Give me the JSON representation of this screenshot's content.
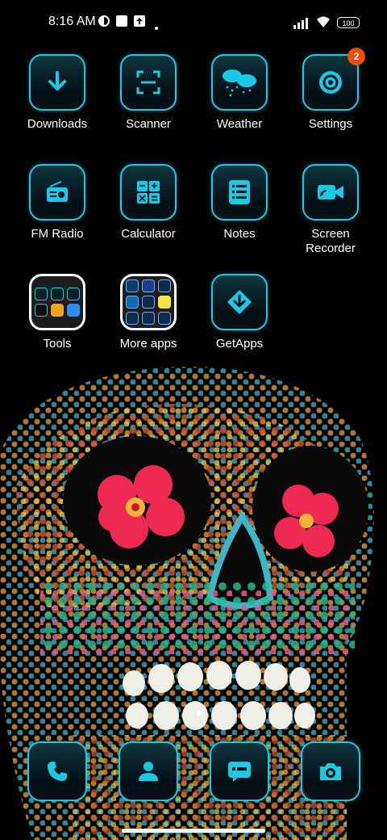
{
  "status_bar": {
    "time": "8:16 AM",
    "battery": "100",
    "icons": [
      "do-not-disturb-icon",
      "notification-square-icon",
      "upload-icon",
      "dot-icon",
      "signal-icon",
      "wifi-icon",
      "battery-icon"
    ]
  },
  "apps": [
    {
      "label": "Downloads",
      "icon": "download-arrow-icon"
    },
    {
      "label": "Scanner",
      "icon": "scanner-icon"
    },
    {
      "label": "Weather",
      "icon": "weather-icon"
    },
    {
      "label": "Settings",
      "icon": "gear-icon",
      "badge": "2"
    },
    {
      "label": "FM Radio",
      "icon": "radio-icon"
    },
    {
      "label": "Calculator",
      "icon": "calculator-icon"
    },
    {
      "label": "Notes",
      "icon": "notes-icon"
    },
    {
      "label": "Screen\nRecorder",
      "icon": "video-camera-icon"
    },
    {
      "label": "Tools",
      "icon": "folder-icon"
    },
    {
      "label": "More apps",
      "icon": "folder-icon"
    },
    {
      "label": "GetApps",
      "icon": "getapps-icon"
    }
  ],
  "dock": [
    {
      "icon": "phone-icon"
    },
    {
      "icon": "contacts-icon"
    },
    {
      "icon": "messages-icon"
    },
    {
      "icon": "camera-icon"
    }
  ],
  "colors": {
    "accent": "#19c9e6",
    "badge": "#f04e0a",
    "background": "#000000"
  }
}
